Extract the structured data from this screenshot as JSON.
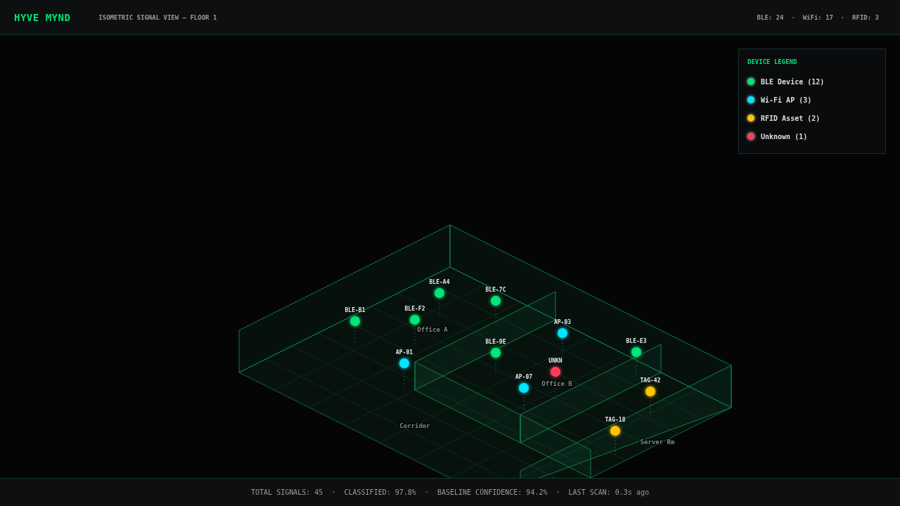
{
  "header": {
    "logo": "HYVE MYND",
    "title": "ISOMETRIC SIGNAL VIEW — FLOOR 1",
    "counts": "BLE: 24  ·  WiFi: 17  ·  RFID: 3"
  },
  "legend": {
    "title": "DEVICE LEGEND",
    "items": [
      {
        "label": "BLE Device (12)",
        "color": "#00e676"
      },
      {
        "label": "Wi-Fi AP (3)",
        "color": "#00e5ff"
      },
      {
        "label": "RFID Asset (2)",
        "color": "#ffc400"
      },
      {
        "label": "Unknown (1)",
        "color": "#ff3d5a"
      }
    ]
  },
  "rooms": [
    "Office A",
    "Office B",
    "Corridor",
    "Server Rm"
  ],
  "devices": [
    {
      "label": "BLE-B1",
      "color": "#00e676"
    },
    {
      "label": "BLE-F2",
      "color": "#00e676"
    },
    {
      "label": "BLE-A4",
      "color": "#00e676"
    },
    {
      "label": "BLE-7C",
      "color": "#00e676"
    },
    {
      "label": "AP-03",
      "color": "#00e5ff"
    },
    {
      "label": "BLE-9E",
      "color": "#00e676"
    },
    {
      "label": "AP-01",
      "color": "#00e5ff"
    },
    {
      "label": "UNKN",
      "color": "#ff3d5a"
    },
    {
      "label": "BLE-E3",
      "color": "#00e676"
    },
    {
      "label": "AP-07",
      "color": "#00e5ff"
    },
    {
      "label": "TAG-42",
      "color": "#ffc400"
    },
    {
      "label": "TAG-18",
      "color": "#ffc400"
    }
  ],
  "status_bar": "TOTAL SIGNALS: 45  ·  CLASSIFIED: 97.8%  ·  BASELINE CONFIDENCE: 94.2%  ·  LAST SCAN: 0.3s ago"
}
